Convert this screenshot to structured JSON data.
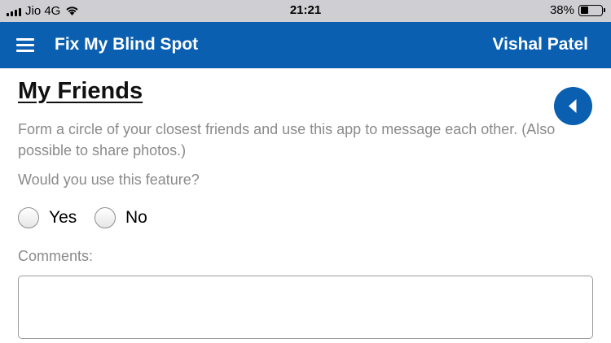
{
  "status_bar": {
    "carrier": "Jio 4G",
    "time": "21:21",
    "battery_percent": "38%",
    "battery_level": 0.38,
    "signal_icon": "signal-bars-icon",
    "wifi_icon": "wifi-icon",
    "battery_icon": "battery-icon"
  },
  "app_bar": {
    "title": "Fix My Blind Spot",
    "user_name": "Vishal Patel",
    "menu_icon": "hamburger-menu-icon",
    "background_color": "#0a5fb0"
  },
  "main": {
    "page_title": "My Friends",
    "back_icon": "triangle-left-icon",
    "description": "Form a circle of your closest friends and use this app to message each other. (Also possible to share photos.)",
    "question": "Would you use this feature?",
    "options": [
      {
        "label": "Yes",
        "selected": false
      },
      {
        "label": "No",
        "selected": false
      }
    ],
    "comments_label": "Comments:",
    "comments_value": ""
  }
}
